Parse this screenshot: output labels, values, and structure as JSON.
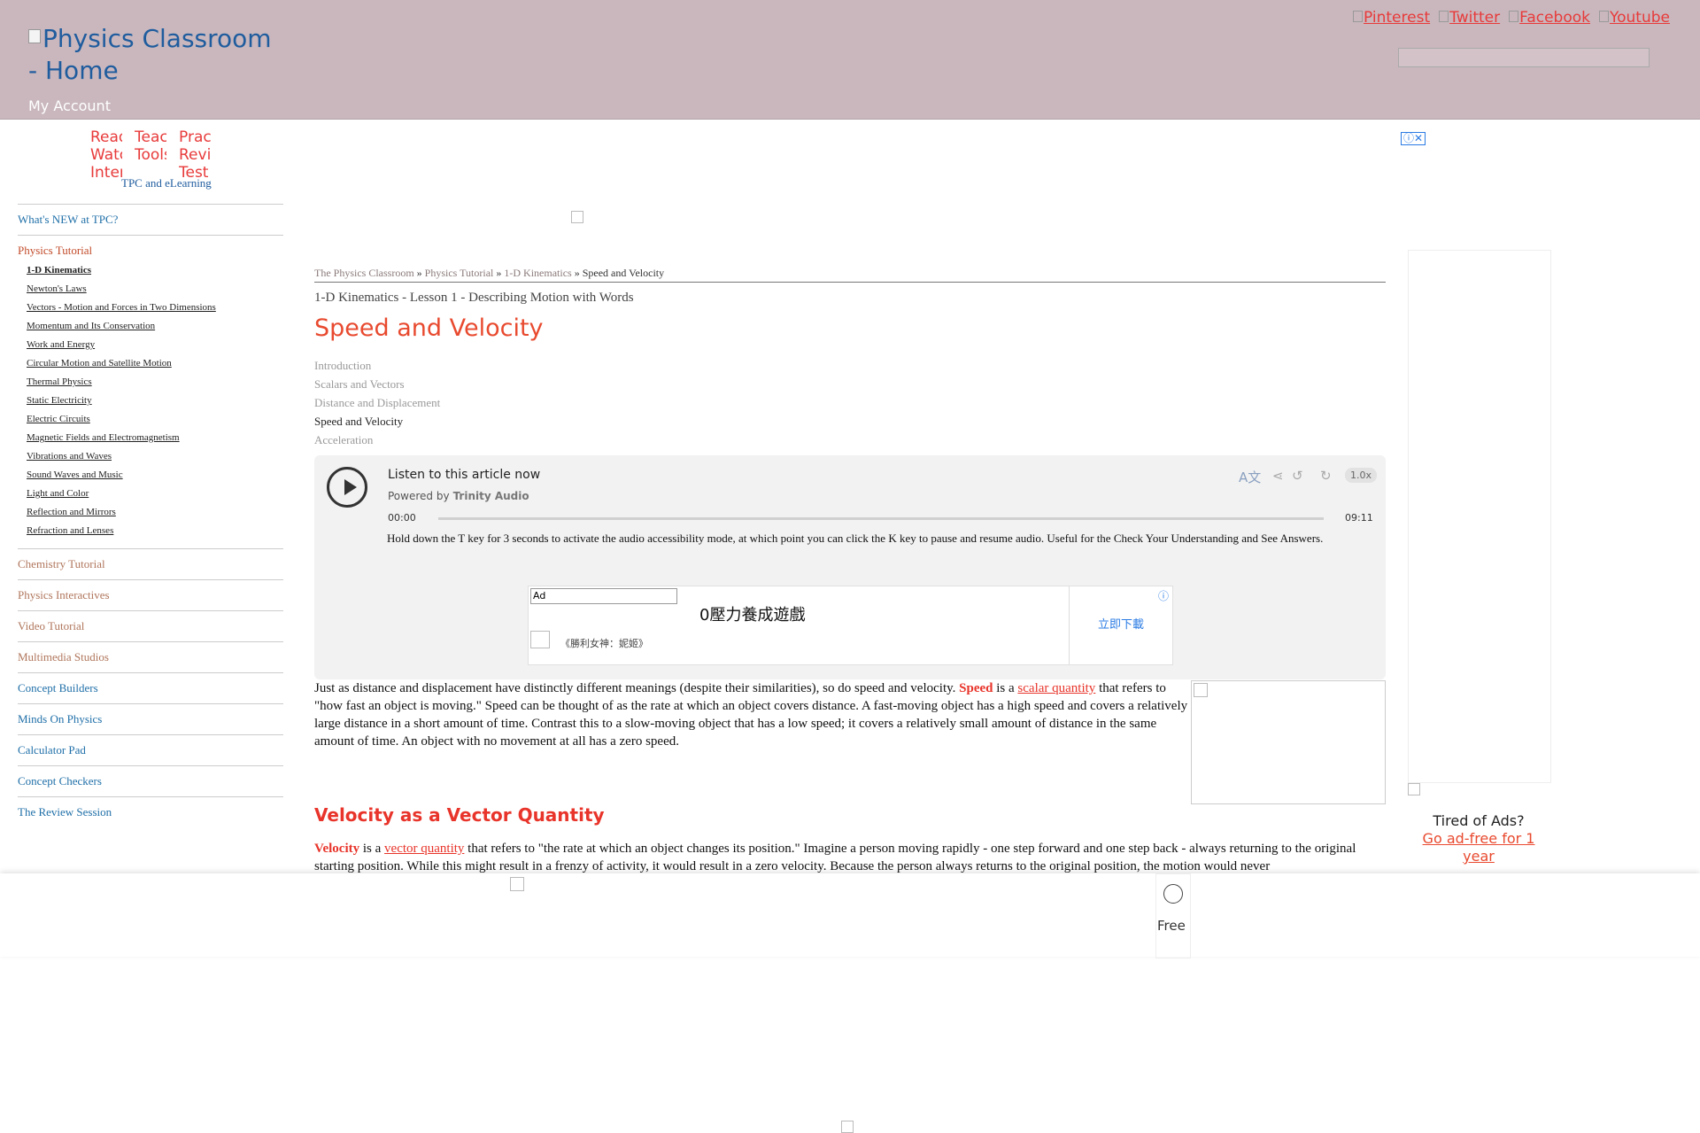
{
  "header": {
    "logo_alt": "Physics Classroom - Home",
    "my_account": "My Account",
    "social": [
      "Pinterest",
      "Twitter",
      "Facebook",
      "Youtube"
    ]
  },
  "quick_links": {
    "items": [
      "Read Watch Interact",
      "Teacher Tools",
      "Practice Review Test"
    ],
    "caption": "TPC and eLearning"
  },
  "sidebar": {
    "whats_new": "What's NEW at TPC?",
    "physics_tutorial": "Physics Tutorial",
    "tutorial_items": [
      "1-D Kinematics",
      "Newton's Laws",
      "Vectors - Motion and Forces in Two Dimensions",
      "Momentum and Its Conservation",
      "Work and Energy",
      "Circular Motion and Satellite Motion",
      "Thermal Physics",
      "Static Electricity",
      "Electric Circuits",
      "Magnetic Fields and Electromagnetism",
      "Vibrations and Waves",
      "Sound Waves and Music",
      "Light and Color",
      "Reflection and Mirrors",
      "Refraction and Lenses"
    ],
    "sections": [
      "Chemistry Tutorial",
      "Physics Interactives",
      "Video Tutorial",
      "Multimedia Studios",
      "Concept Builders",
      "Minds On Physics",
      "Calculator Pad",
      "Concept Checkers",
      "The Review Session"
    ]
  },
  "breadcrumb": {
    "items": [
      "The Physics Classroom",
      "Physics Tutorial",
      "1-D Kinematics"
    ],
    "current": "Speed and Velocity",
    "sep": "»"
  },
  "lesson": "1-D Kinematics - Lesson 1 - Describing Motion with Words",
  "title": "Speed and Velocity",
  "toc": [
    "Introduction",
    "Scalars and Vectors",
    "Distance and Displacement",
    "Speed and Velocity",
    "Acceleration"
  ],
  "player": {
    "listen": "Listen to this article now",
    "powered": "Powered by",
    "brand": "Trinity Audio",
    "time_start": "00:00",
    "time_end": "09:11",
    "speed": "1.0x",
    "hint": "Hold down the T key for 3 seconds to activate the audio accessibility mode, at which point you can click the K key to pause and resume audio. Useful for the Check Your Understanding and See Answers."
  },
  "ad": {
    "tag": "Ad",
    "headline": "0壓力養成遊戲",
    "sub": "《勝利女神：妮姬》",
    "cta": "立即下載",
    "info": "ⓘ"
  },
  "paragraph1": {
    "before": "Just as distance and displacement have distinctly different meanings (despite their similarities), so do speed and velocity.",
    "kw": "Speed",
    "mid": "is a",
    "link": "scalar quantity",
    "after": "that refers to \"how fast an object is moving.\" Speed can be thought of as the rate at which an object covers distance. A fast-moving object has a high speed and covers a relatively large distance in a short amount of time. Contrast this to a slow-moving object that has a low speed; it covers a relatively small amount of distance in the same amount of time. An object with no movement at all has a zero speed."
  },
  "heading2": "Velocity as a Vector Quantity",
  "paragraph2": {
    "kw": "Velocity",
    "mid": "is a",
    "link": "vector quantity",
    "after": "that refers to \"the rate at which an object changes its position.\" Imagine a person moving rapidly - one step forward and one step back - always returning to the original starting position. While this might result in a frenzy of activity, it would result in a zero velocity. Because the person always returns to the original position, the motion would never"
  },
  "right": {
    "tired": "Tired of Ads?",
    "adfree": "Go ad-free for 1 year"
  },
  "bottom": {
    "free_label": "Free"
  }
}
